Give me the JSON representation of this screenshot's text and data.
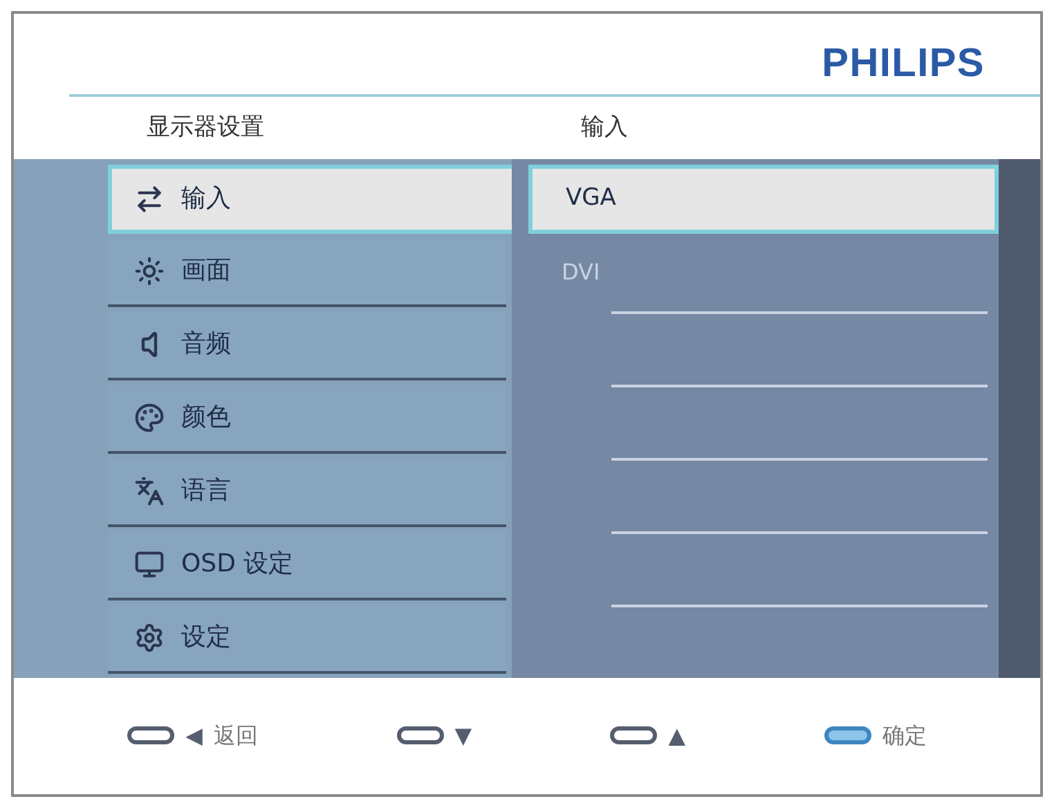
{
  "logo": "PHILIPS",
  "headers": {
    "menu": "显示器设置",
    "submenu": "输入"
  },
  "menu": [
    {
      "label": "输入",
      "kind": "input",
      "selected": true
    },
    {
      "label": "画面",
      "kind": "picture",
      "selected": false
    },
    {
      "label": "音频",
      "kind": "audio",
      "selected": false
    },
    {
      "label": "颜色",
      "kind": "color",
      "selected": false
    },
    {
      "label": "语言",
      "kind": "language",
      "selected": false
    },
    {
      "label": "OSD 设定",
      "kind": "osd",
      "selected": false
    },
    {
      "label": "设定",
      "kind": "setup",
      "selected": false
    }
  ],
  "submenu": [
    {
      "label": "VGA",
      "selected": true
    },
    {
      "label": "DVI",
      "selected": false
    }
  ],
  "keys": [
    {
      "symbol": "◀",
      "label": "返回",
      "highlighted": false
    },
    {
      "symbol": "▼",
      "highlighted": false
    },
    {
      "symbol": "▲",
      "highlighted": false
    },
    {
      "label": "确定",
      "highlighted": true
    }
  ]
}
